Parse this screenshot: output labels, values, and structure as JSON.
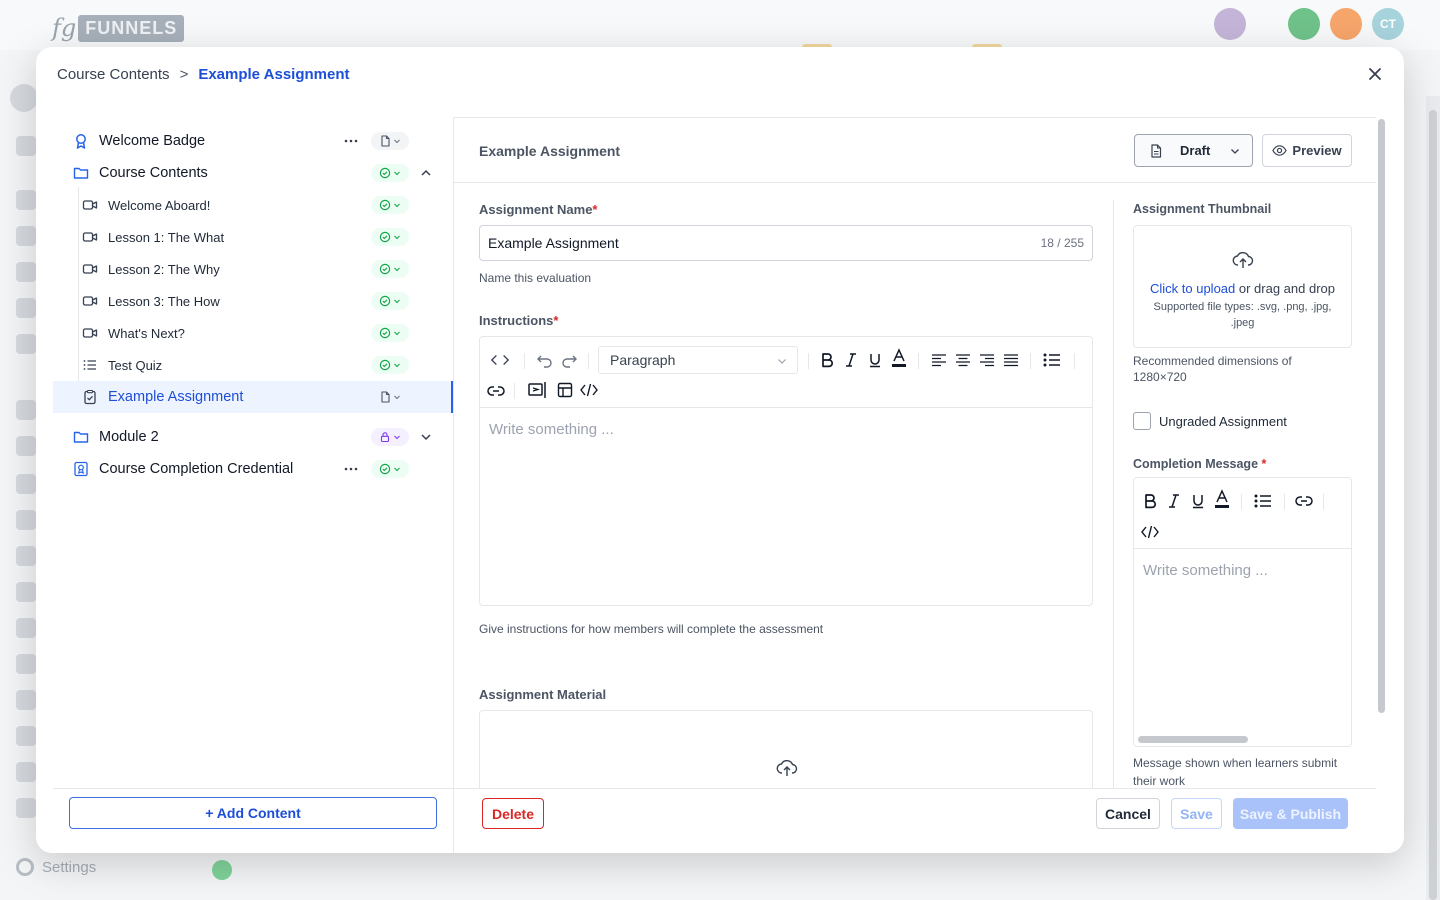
{
  "background": {
    "logo_prefix": "fg",
    "logo_text": "FUNNELS",
    "settings_label": "Settings",
    "avatar_initials": "CT"
  },
  "breadcrumb": {
    "root": "Course Contents",
    "separator": ">",
    "current": "Example Assignment"
  },
  "tree": {
    "items": [
      {
        "label": "Welcome Badge",
        "icon": "badge-icon",
        "status": "draft",
        "has_menu": true
      },
      {
        "label": "Course Contents",
        "icon": "folder-icon",
        "status": "published",
        "expanded": true
      },
      {
        "label": "Welcome Aboard!",
        "icon": "video-icon",
        "status": "published"
      },
      {
        "label": "Lesson 1: The What",
        "icon": "video-icon",
        "status": "published"
      },
      {
        "label": "Lesson 2: The Why",
        "icon": "video-icon",
        "status": "published"
      },
      {
        "label": "Lesson 3: The How",
        "icon": "video-icon",
        "status": "published"
      },
      {
        "label": "What's Next?",
        "icon": "video-icon",
        "status": "published"
      },
      {
        "label": "Test Quiz",
        "icon": "list-icon",
        "status": "published"
      },
      {
        "label": "Example Assignment",
        "icon": "clipboard-check-icon",
        "status": "draft",
        "selected": true
      },
      {
        "label": "Module 2",
        "icon": "folder-icon",
        "status": "locked",
        "expanded": false
      },
      {
        "label": "Course Completion Credential",
        "icon": "certificate-icon",
        "status": "published",
        "has_menu": true
      }
    ],
    "add_content_label": "+ Add Content"
  },
  "editor": {
    "title": "Example Assignment",
    "status_label": "Draft",
    "preview_label": "Preview",
    "name_label": "Assignment Name",
    "required_mark": "*",
    "name_value": "Example Assignment",
    "name_counter": "18 / 255",
    "name_help": "Name this evaluation",
    "instructions_label": "Instructions",
    "paragraph_option": "Paragraph",
    "instructions_placeholder": "Write something ...",
    "instructions_help": "Give instructions for how members will complete the assessment",
    "material_label": "Assignment Material"
  },
  "sidebar_right": {
    "thumbnail_label": "Assignment Thumbnail",
    "upload_link": "Click to upload",
    "upload_rest": " or drag and drop",
    "file_types": "Supported file types: .svg, .png, .jpg, .jpeg",
    "recommended": "Recommended dimensions of 1280×720",
    "ungraded_label": "Ungraded Assignment",
    "completion_label": "Completion Message",
    "completion_required": " *",
    "completion_placeholder": "Write something ...",
    "completion_help": "Message shown when learners submit their work"
  },
  "footer": {
    "delete_label": "Delete",
    "cancel_label": "Cancel",
    "save_label": "Save",
    "publish_label": "Save & Publish"
  },
  "colors": {
    "accent": "#1d4ed8",
    "danger": "#dc2626",
    "success": "#16a34a",
    "locked": "#7c3aed"
  }
}
